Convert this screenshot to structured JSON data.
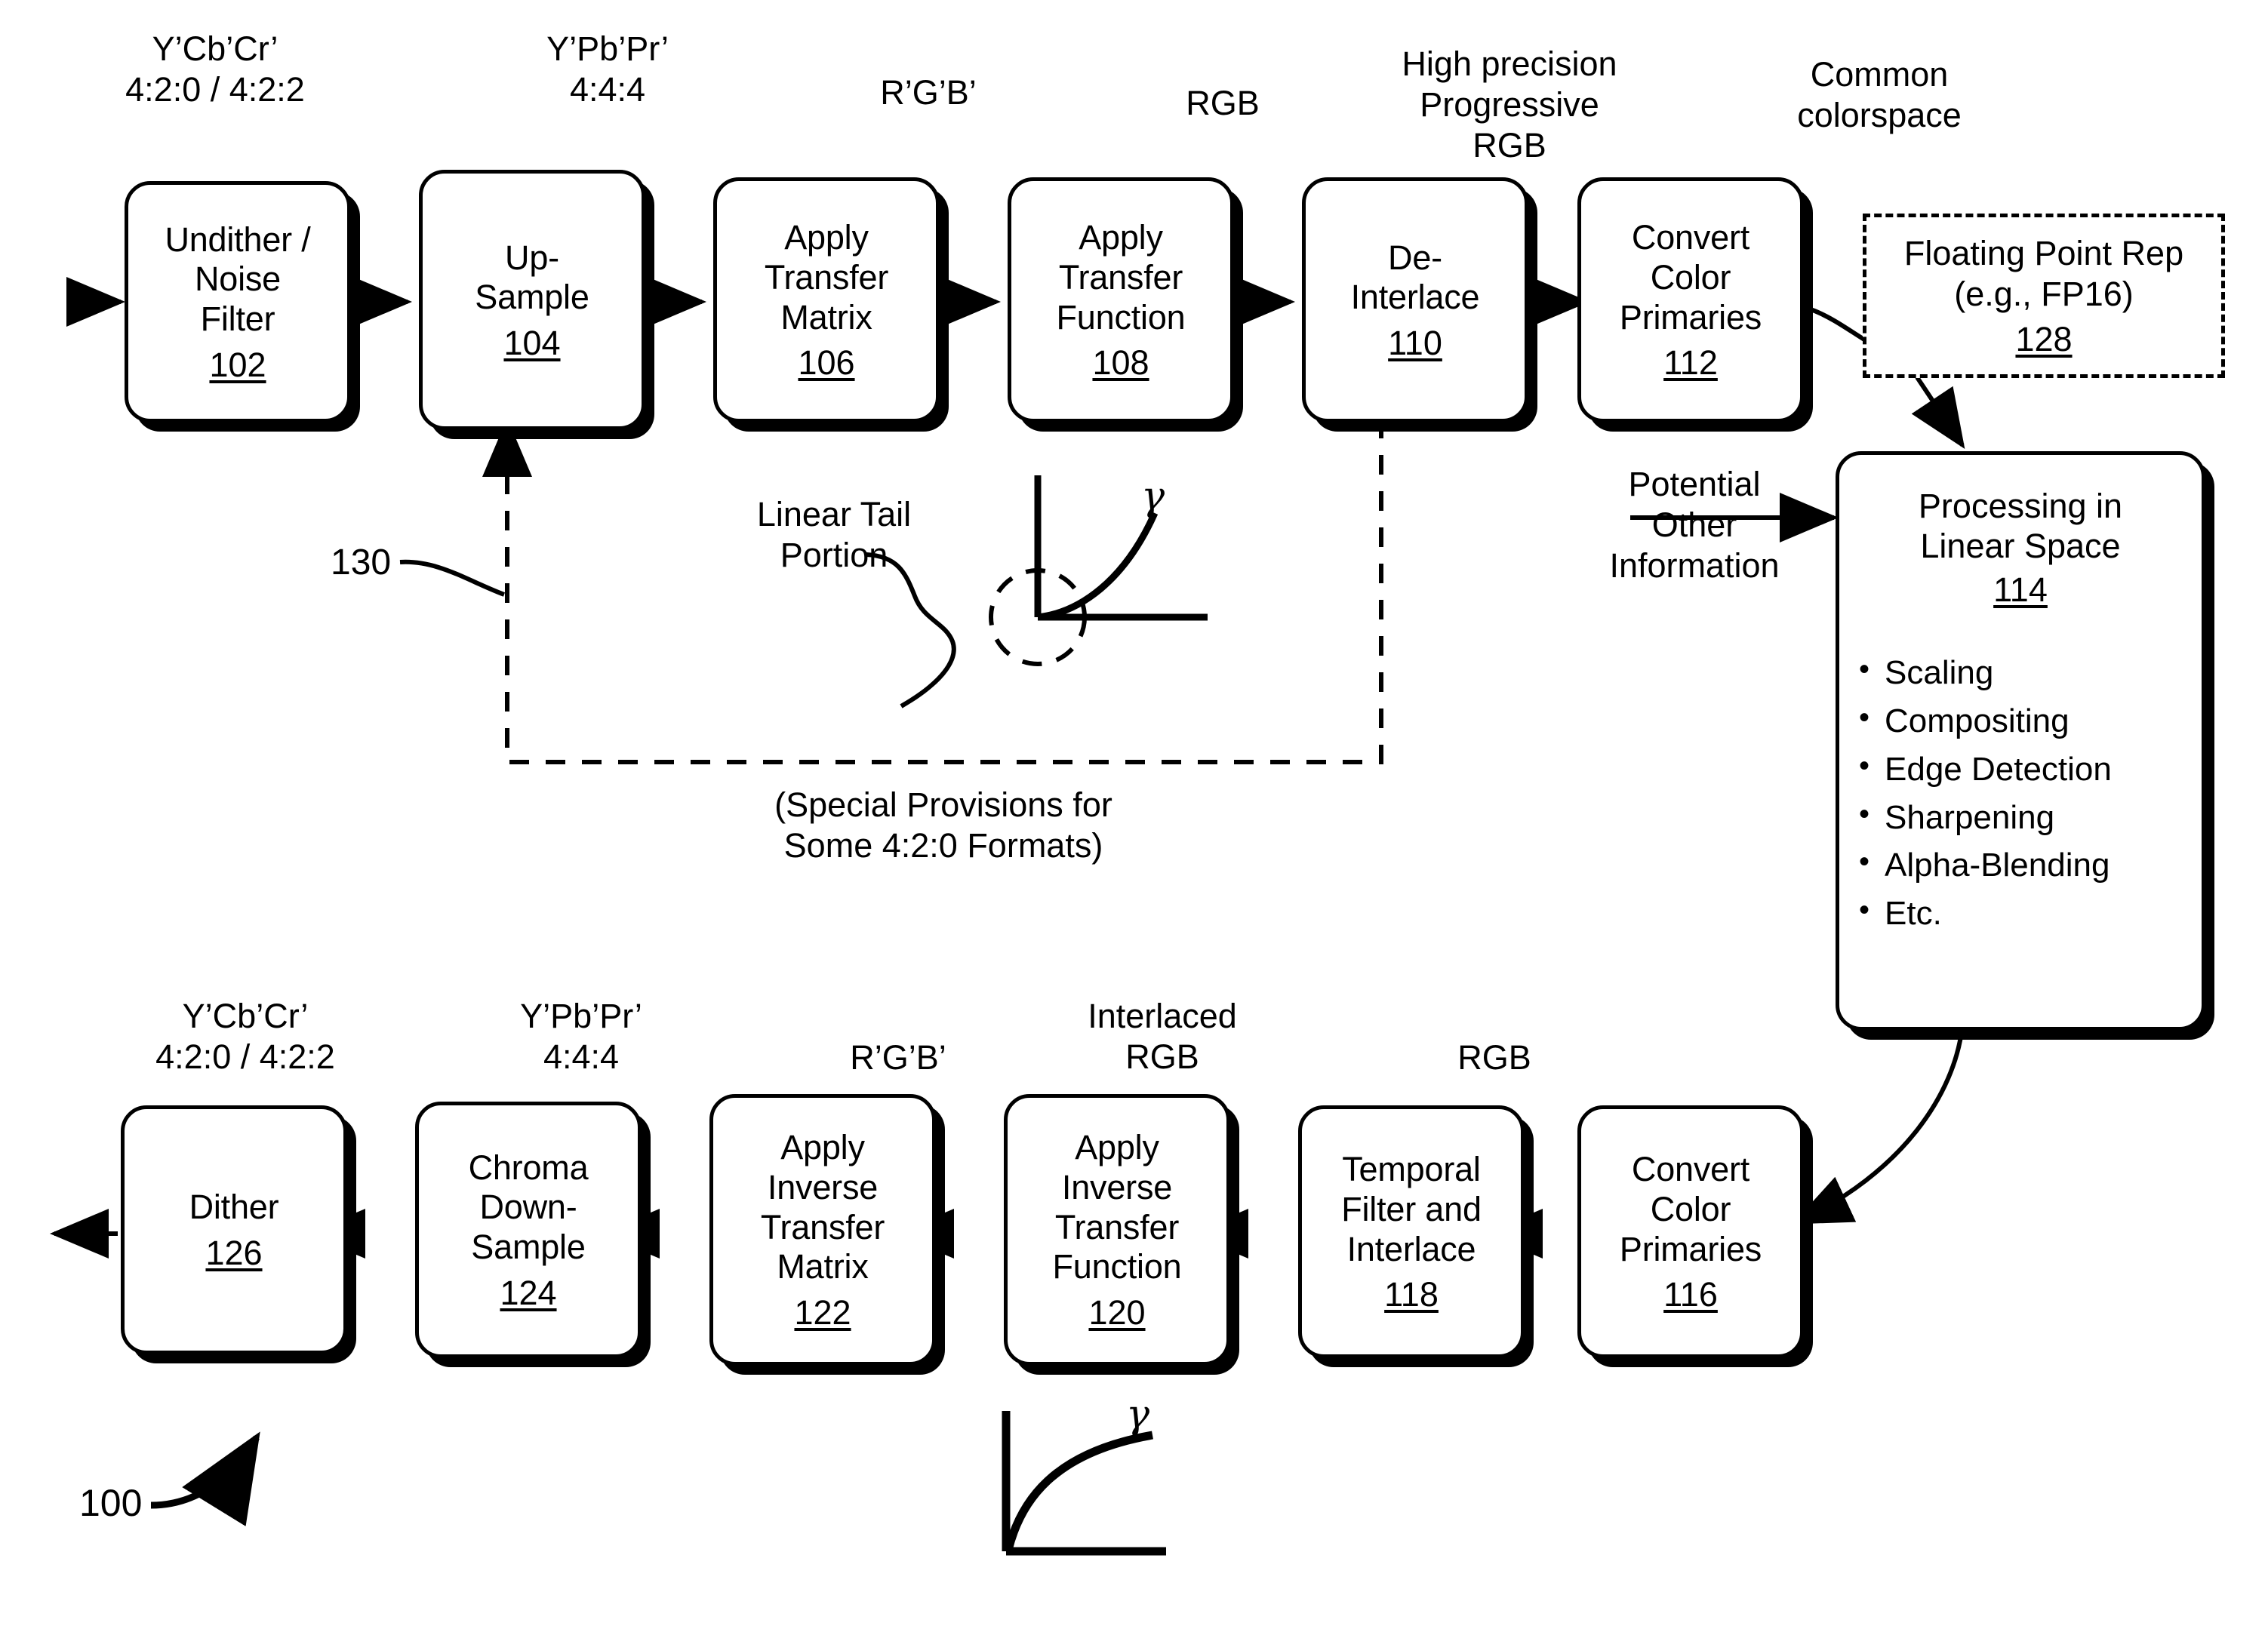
{
  "figure": {
    "reference_number": "100",
    "title": "Video processing pipeline"
  },
  "top_row": {
    "signal_labels": [
      {
        "text": "Y’Cb’Cr’\n4:2:0 / 4:2:2"
      },
      {
        "text": "Y’Pb’Pr’\n4:4:4"
      },
      {
        "text": "R’G’B’"
      },
      {
        "text": "RGB"
      },
      {
        "text": "High precision\nProgressive\nRGB"
      },
      {
        "text": "Common\ncolorspace"
      }
    ],
    "boxes": [
      {
        "title": "Undither /\nNoise\nFilter",
        "num": "102"
      },
      {
        "title": "Up-\nSample",
        "num": "104"
      },
      {
        "title": "Apply\nTransfer\nMatrix",
        "num": "106"
      },
      {
        "title": "Apply\nTransfer\nFunction",
        "num": "108"
      },
      {
        "title": "De-\nInterlace",
        "num": "110"
      },
      {
        "title": "Convert\nColor\nPrimaries",
        "num": "112"
      }
    ]
  },
  "floating_point_box": {
    "title": "Floating Point Rep\n(e.g., FP16)",
    "num": "128"
  },
  "processing_box": {
    "title": "Processing in\nLinear Space",
    "num": "114",
    "bullets": [
      "Scaling",
      "Compositing",
      "Edge Detection",
      "Sharpening",
      "Alpha-Blending",
      "Etc."
    ]
  },
  "annotations": {
    "potential_other_information": "Potential\nOther\nInformation",
    "linear_tail_portion": "Linear Tail\nPortion",
    "gamma_symbol": "γ",
    "feedback_ref": "130",
    "feedback_caption": "(Special Provisions for\nSome 4:2:0 Formats)"
  },
  "bottom_row": {
    "signal_labels": [
      {
        "text": "Y’Cb’Cr’\n4:2:0 / 4:2:2"
      },
      {
        "text": "Y’Pb’Pr’\n4:4:4"
      },
      {
        "text": "R’G’B’"
      },
      {
        "text": "Interlaced\nRGB"
      },
      {
        "text": "RGB"
      }
    ],
    "boxes": [
      {
        "title": "Dither",
        "num": "126"
      },
      {
        "title": "Chroma\nDown-\nSample",
        "num": "124"
      },
      {
        "title": "Apply\nInverse\nTransfer\nMatrix",
        "num": "122"
      },
      {
        "title": "Apply\nInverse\nTransfer\nFunction",
        "num": "120"
      },
      {
        "title": "Temporal\nFilter and\nInterlace",
        "num": "118"
      },
      {
        "title": "Convert\nColor\nPrimaries",
        "num": "116"
      }
    ]
  },
  "colors": {
    "ink": "#000000",
    "paper": "#ffffff"
  }
}
